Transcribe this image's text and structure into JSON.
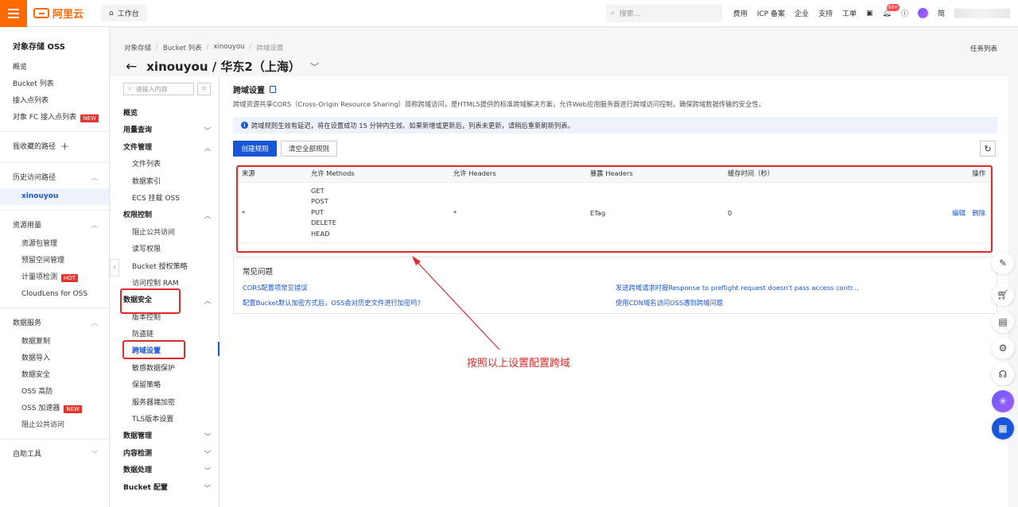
{
  "topbar": {
    "logo_text": "阿里云",
    "workbench": "工作台",
    "search_placeholder": "搜索...",
    "links": [
      "费用",
      "ICP 备案",
      "企业",
      "支持",
      "工单"
    ],
    "bell_badge": "99+",
    "lang": "简"
  },
  "leftnav": {
    "title": "对象存储 OSS",
    "items_top": [
      "概览",
      "Bucket 列表",
      "接入点列表"
    ],
    "fc_item": "对象 FC 接入点列表",
    "new_tag": "NEW",
    "favorites": "我收藏的路径",
    "history": "历史访问路径",
    "history_active": "xinouyou",
    "resource": "资源用量",
    "resource_items": [
      "资源包管理",
      "预留空间管理"
    ],
    "meter_item": "计量项检测",
    "hot_tag": "HOT",
    "cloudlens": "CloudLens for OSS",
    "data_service": "数据服务",
    "data_items": [
      "数据复制",
      "数据导入",
      "数据安全",
      "OSS 高防"
    ],
    "accelerator": "OSS 加速器",
    "block_public": "阻止公共访问",
    "tools": "自助工具"
  },
  "subnav": {
    "search_placeholder": "请输入内容",
    "overview": "概览",
    "usage": "用量查询",
    "file_mgmt": "文件管理",
    "file_items": [
      "文件列表",
      "数据索引",
      "ECS 挂载 OSS"
    ],
    "perm": "权限控制",
    "perm_items": [
      "阻止公共访问",
      "读写权限",
      "Bucket 授权策略",
      "访问控制 RAM"
    ],
    "security": "数据安全",
    "security_items": [
      "版本控制",
      "防盗链"
    ],
    "cors": "跨域设置",
    "security_items2": [
      "敏感数据保护",
      "保留策略",
      "服务器端加密",
      "TLS版本设置"
    ],
    "groups_bottom": [
      "数据管理",
      "内容检测",
      "数据处理",
      "Bucket 配置"
    ]
  },
  "breadcrumb": [
    "对象存储",
    "Bucket 列表",
    "xinouyou",
    "跨域设置"
  ],
  "page_title": "xinouyou / 华东2（上海）",
  "task_list": "任务列表",
  "section": {
    "title": "跨域设置",
    "desc": "跨域资源共享CORS（Cross-Origin Resource Sharing）简称跨域访问，是HTML5提供的标准跨域解决方案，允许Web应用服务器进行跨域访问控制，确保跨域数据传输的安全性。",
    "notice": "跨域规则生效有延迟，将在设置成功 15 分钟内生效。如果新增或更新后，列表未更新，请稍后重新刷新列表。",
    "btn_create": "创建规则",
    "btn_clear": "清空全部规则"
  },
  "table": {
    "headers": [
      "来源",
      "允许 Methods",
      "允许 Headers",
      "暴露 Headers",
      "缓存时间（秒）",
      "操作"
    ],
    "row": {
      "origin": "*",
      "methods": [
        "GET",
        "POST",
        "PUT",
        "DELETE",
        "HEAD"
      ],
      "allow_headers": "*",
      "expose_headers": "ETag",
      "max_age": "0",
      "edit": "编辑",
      "delete": "删除"
    }
  },
  "faq": {
    "title": "常见问题",
    "links": [
      "CORS配置项常见错误",
      "配置Bucket默认加密方式后，OSS会对历史文件进行加密吗?",
      "发送跨域请求时报Response to preflight request doesn't pass access contr...",
      "使用CDN域名访问OSS遇到跨域问题"
    ]
  },
  "annotation": "按照以上设置配置跨域",
  "colors": {
    "brand": "#ff6a00",
    "primary": "#1756d6",
    "annotation": "#e02b2b"
  }
}
